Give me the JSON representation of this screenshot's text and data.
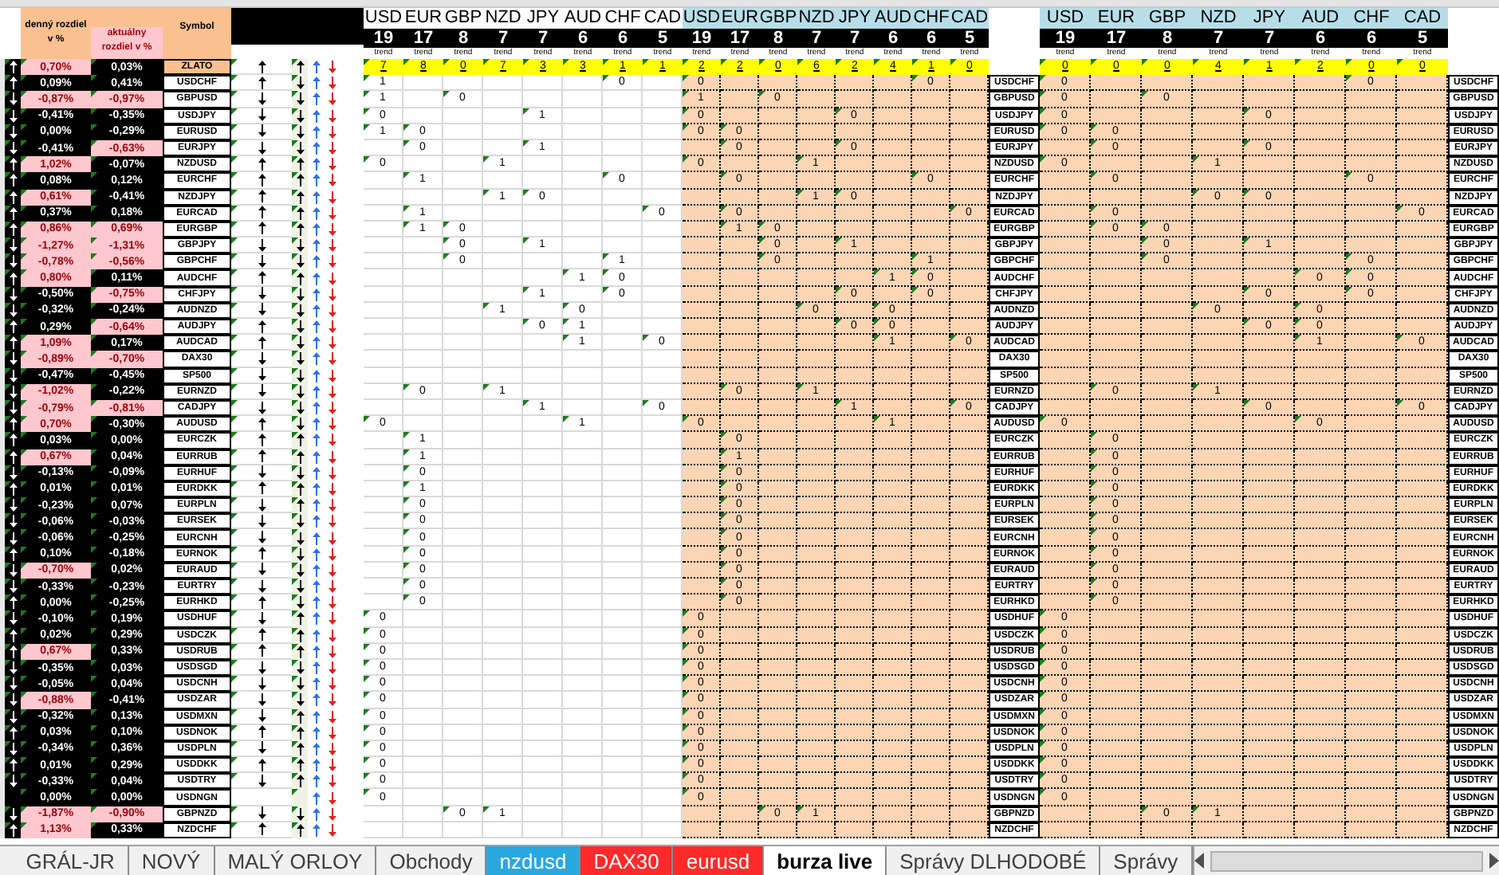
{
  "header": {
    "daily_label": "denný rozdiel v %",
    "current_label": "aktuálny rozdiel v %",
    "symbol_label": "Symbol"
  },
  "tables": [
    {
      "columns": [
        {
          "code": "USD",
          "count": "19",
          "trend": "trend",
          "score": "7"
        },
        {
          "code": "EUR",
          "count": "17",
          "trend": "trend",
          "score": "8"
        },
        {
          "code": "GBP",
          "count": "8",
          "trend": "trend",
          "score": "0"
        },
        {
          "code": "NZD",
          "count": "7",
          "trend": "trend",
          "score": "7"
        },
        {
          "code": "JPY",
          "count": "7",
          "trend": "trend",
          "score": "3"
        },
        {
          "code": "AUD",
          "count": "6",
          "trend": "trend",
          "score": "3"
        },
        {
          "code": "CHF",
          "count": "6",
          "trend": "trend",
          "score": "1"
        },
        {
          "code": "CAD",
          "count": "5",
          "trend": "trend",
          "score": "1"
        }
      ]
    },
    {
      "columns": [
        {
          "code": "USD",
          "count": "19",
          "trend": "trend",
          "score": "2"
        },
        {
          "code": "EUR",
          "count": "17",
          "trend": "trend",
          "score": "2"
        },
        {
          "code": "GBP",
          "count": "8",
          "trend": "trend",
          "score": "0"
        },
        {
          "code": "NZD",
          "count": "7",
          "trend": "trend",
          "score": "6"
        },
        {
          "code": "JPY",
          "count": "7",
          "trend": "trend",
          "score": "2"
        },
        {
          "code": "AUD",
          "count": "6",
          "trend": "trend",
          "score": "4"
        },
        {
          "code": "CHF",
          "count": "6",
          "trend": "trend",
          "score": "1"
        },
        {
          "code": "CAD",
          "count": "5",
          "trend": "trend",
          "score": "0"
        }
      ]
    },
    {
      "columns": [
        {
          "code": "USD",
          "count": "19",
          "trend": "trend",
          "score": "0"
        },
        {
          "code": "EUR",
          "count": "17",
          "trend": "trend",
          "score": "0"
        },
        {
          "code": "GBP",
          "count": "8",
          "trend": "trend",
          "score": "0"
        },
        {
          "code": "NZD",
          "count": "7",
          "trend": "trend",
          "score": "4"
        },
        {
          "code": "JPY",
          "count": "7",
          "trend": "trend",
          "score": "1"
        },
        {
          "code": "AUD",
          "count": "6",
          "trend": "trend",
          "score": "2"
        },
        {
          "code": "CHF",
          "count": "6",
          "trend": "trend",
          "score": "0"
        },
        {
          "code": "CAD",
          "count": "5",
          "trend": "trend",
          "score": "0"
        }
      ]
    }
  ],
  "rows": [
    {
      "symbol": "ZLATO",
      "symbol_highlight": true,
      "daily": "0,70%",
      "daily_flag": true,
      "current": "0,03%",
      "current_flag": false,
      "a_up": true,
      "b_up": true,
      "c_up": true
    },
    {
      "symbol": "USDCHF",
      "symbol_mid": "USDCHF",
      "symbol_right": "USDCHF",
      "daily": "0,09%",
      "daily_flag": false,
      "current": "0,41%",
      "current_flag": false,
      "a_up": true,
      "b_up": true,
      "c_up": false,
      "t1": {
        "usd": "1",
        "chf": "0"
      },
      "t2": {
        "usd": "0",
        "chf": "0"
      },
      "t3": {
        "usd": "0",
        "chf": "0"
      }
    },
    {
      "symbol": "GBPUSD",
      "symbol_mid": "GBPUSD",
      "symbol_right": "GBPUSD",
      "daily": "-0,87%",
      "daily_flag": true,
      "current": "-0,97%",
      "current_flag": true,
      "a_up": false,
      "b_up": false,
      "c_up": false,
      "t1": {
        "usd": "1",
        "gbp": "0"
      },
      "t2": {
        "usd": "1",
        "gbp": "0"
      },
      "t3": {
        "usd": "0",
        "gbp": "0"
      }
    },
    {
      "symbol": "USDJPY",
      "symbol_mid": "USDJPY",
      "symbol_right": "USDJPY",
      "daily": "-0,41%",
      "daily_flag": false,
      "current": "-0,35%",
      "current_flag": false,
      "a_up": false,
      "b_up": false,
      "c_up": false,
      "t1": {
        "usd": "0",
        "jpy": "1"
      },
      "t2": {
        "usd": "0",
        "jpy": "0"
      },
      "t3": {
        "usd": "0",
        "jpy": "0"
      }
    },
    {
      "symbol": "EURUSD",
      "symbol_mid": "EURUSD",
      "symbol_right": "EURUSD",
      "daily": "0,00%",
      "daily_flag": false,
      "current": "-0,29%",
      "current_flag": false,
      "a_up": false,
      "b_up": false,
      "c_up": false,
      "t1": {
        "usd": "1",
        "eur": "0"
      },
      "t2": {
        "usd": "0",
        "eur": "0"
      },
      "t3": {
        "usd": "0",
        "eur": "0"
      }
    },
    {
      "symbol": "EURJPY",
      "symbol_mid": "EURJPY",
      "symbol_right": "EURJPY",
      "daily": "-0,41%",
      "daily_flag": false,
      "current": "-0,63%",
      "current_flag": true,
      "a_up": false,
      "b_up": false,
      "c_up": false,
      "t1": {
        "eur": "0",
        "jpy": "1"
      },
      "t2": {
        "eur": "0",
        "jpy": "0"
      },
      "t3": {
        "eur": "0",
        "jpy": "0"
      }
    },
    {
      "symbol": "NZDUSD",
      "symbol_mid": "NZDUSD",
      "symbol_right": "NZDUSD",
      "daily": "1,02%",
      "daily_flag": true,
      "current": "-0,07%",
      "current_flag": false,
      "a_up": true,
      "b_up": true,
      "c_up": true,
      "t1": {
        "usd": "0",
        "nzd": "1"
      },
      "t2": {
        "usd": "0",
        "nzd": "1"
      },
      "t3": {
        "usd": "0",
        "nzd": "1"
      }
    },
    {
      "symbol": "EURCHF",
      "symbol_mid": "EURCHF",
      "symbol_right": "EURCHF",
      "daily": "0,08%",
      "daily_flag": false,
      "current": "0,12%",
      "current_flag": false,
      "a_up": true,
      "b_up": true,
      "c_up": true,
      "t1": {
        "eur": "1",
        "chf": "0"
      },
      "t2": {
        "eur": "0",
        "chf": "0"
      },
      "t3": {
        "eur": "0",
        "chf": "0"
      }
    },
    {
      "symbol": "NZDJPY",
      "symbol_mid": "NZDJPY",
      "symbol_right": "NZDJPY",
      "daily": "0,61%",
      "daily_flag": true,
      "current": "-0,41%",
      "current_flag": false,
      "a_up": true,
      "b_up": true,
      "c_up": true,
      "t1": {
        "nzd": "1",
        "jpy": "0"
      },
      "t2": {
        "nzd": "1",
        "jpy": "0"
      },
      "t3": {
        "nzd": "0",
        "jpy": "0"
      }
    },
    {
      "symbol": "EURCAD",
      "symbol_mid": "EURCAD",
      "symbol_right": "EURCAD",
      "daily": "0,37%",
      "daily_flag": false,
      "current": "0,18%",
      "current_flag": false,
      "a_up": true,
      "b_up": true,
      "c_up": true,
      "t1": {
        "eur": "1",
        "cad": "0"
      },
      "t2": {
        "eur": "0",
        "cad": "0"
      },
      "t3": {
        "eur": "0",
        "cad": "0"
      }
    },
    {
      "symbol": "EURGBP",
      "symbol_mid": "EURGBP",
      "symbol_right": "EURGBP",
      "daily": "0,86%",
      "daily_flag": true,
      "current": "0,69%",
      "current_flag": true,
      "a_up": true,
      "b_up": true,
      "c_up": true,
      "t1": {
        "eur": "1",
        "gbp": "0"
      },
      "t2": {
        "eur": "1",
        "gbp": "0"
      },
      "t3": {
        "eur": "0",
        "gbp": "0"
      }
    },
    {
      "symbol": "GBPJPY",
      "symbol_mid": "GBPJPY",
      "symbol_right": "GBPJPY",
      "daily": "-1,27%",
      "daily_flag": true,
      "current": "-1,31%",
      "current_flag": true,
      "a_up": false,
      "b_up": false,
      "c_up": false,
      "t1": {
        "gbp": "0",
        "jpy": "1"
      },
      "t2": {
        "gbp": "0",
        "jpy": "1"
      },
      "t3": {
        "gbp": "0",
        "jpy": "1"
      }
    },
    {
      "symbol": "GBPCHF",
      "symbol_mid": "GBPCHF",
      "symbol_right": "GBPCHF",
      "daily": "-0,78%",
      "daily_flag": true,
      "current": "-0,56%",
      "current_flag": true,
      "a_up": false,
      "b_up": false,
      "c_up": false,
      "t1": {
        "gbp": "0",
        "chf": "1"
      },
      "t2": {
        "gbp": "0",
        "chf": "1"
      },
      "t3": {
        "gbp": "0",
        "chf": "0"
      }
    },
    {
      "symbol": "AUDCHF",
      "symbol_mid": "AUDCHF",
      "symbol_right": "AUDCHF",
      "daily": "0,80%",
      "daily_flag": true,
      "current": "0,11%",
      "current_flag": false,
      "a_up": true,
      "b_up": true,
      "c_up": true,
      "t1": {
        "aud": "1",
        "chf": "0"
      },
      "t2": {
        "aud": "1",
        "chf": "0"
      },
      "t3": {
        "aud": "0",
        "chf": "0"
      }
    },
    {
      "symbol": "CHFJPY",
      "symbol_mid": "CHFJPY",
      "symbol_right": "CHFJPY",
      "daily": "-0,50%",
      "daily_flag": false,
      "current": "-0,75%",
      "current_flag": true,
      "a_up": false,
      "b_up": false,
      "c_up": false,
      "t1": {
        "jpy": "1",
        "chf": "0"
      },
      "t2": {
        "jpy": "0",
        "chf": "0"
      },
      "t3": {
        "jpy": "0",
        "chf": "0"
      }
    },
    {
      "symbol": "AUDNZD",
      "symbol_mid": "AUDNZD",
      "symbol_right": "AUDNZD",
      "daily": "-0,32%",
      "daily_flag": false,
      "current": "-0,24%",
      "current_flag": false,
      "a_up": false,
      "b_up": false,
      "c_up": false,
      "t1": {
        "nzd": "1",
        "aud": "0"
      },
      "t2": {
        "nzd": "0",
        "aud": "0"
      },
      "t3": {
        "nzd": "0",
        "aud": "0"
      }
    },
    {
      "symbol": "AUDJPY",
      "symbol_mid": "AUDJPY",
      "symbol_right": "AUDJPY",
      "daily": "0,29%",
      "daily_flag": false,
      "current": "-0,64%",
      "current_flag": true,
      "a_up": true,
      "b_up": true,
      "c_up": false,
      "t1": {
        "jpy": "0",
        "aud": "1"
      },
      "t2": {
        "jpy": "0",
        "aud": "0"
      },
      "t3": {
        "jpy": "0",
        "aud": "0"
      }
    },
    {
      "symbol": "AUDCAD",
      "symbol_mid": "AUDCAD",
      "symbol_right": "AUDCAD",
      "daily": "1,09%",
      "daily_flag": true,
      "current": "0,17%",
      "current_flag": false,
      "a_up": true,
      "b_up": true,
      "c_up": false,
      "t1": {
        "aud": "1",
        "cad": "0"
      },
      "t2": {
        "aud": "1",
        "cad": "0"
      },
      "t3": {
        "aud": "1",
        "cad": "0"
      }
    },
    {
      "symbol": "DAX30",
      "symbol_mid": "DAX30",
      "symbol_right": "DAX30",
      "daily": "-0,89%",
      "daily_flag": true,
      "current": "-0,70%",
      "current_flag": true,
      "a_up": false,
      "b_up": false,
      "c_up": false
    },
    {
      "symbol": "SP500",
      "symbol_mid": "SP500",
      "symbol_right": "SP500",
      "daily": "-0,47%",
      "daily_flag": false,
      "current": "-0,45%",
      "current_flag": false,
      "a_up": false,
      "b_up": false,
      "c_up": false
    },
    {
      "symbol": "EURNZD",
      "symbol_mid": "EURNZD",
      "symbol_right": "EURNZD",
      "daily": "-1,02%",
      "daily_flag": true,
      "current": "-0,22%",
      "current_flag": false,
      "a_up": false,
      "b_up": false,
      "c_up": false,
      "t1": {
        "eur": "0",
        "nzd": "1"
      },
      "t2": {
        "eur": "0",
        "nzd": "1"
      },
      "t3": {
        "eur": "0",
        "nzd": "1"
      }
    },
    {
      "symbol": "CADJPY",
      "symbol_mid": "CADJPY",
      "symbol_right": "CADJPY",
      "daily": "-0,79%",
      "daily_flag": true,
      "current": "-0,81%",
      "current_flag": true,
      "a_up": false,
      "b_up": false,
      "c_up": false,
      "t1": {
        "jpy": "1",
        "cad": "0"
      },
      "t2": {
        "jpy": "1",
        "cad": "0"
      },
      "t3": {
        "jpy": "0",
        "cad": "0"
      }
    },
    {
      "symbol": "AUDUSD",
      "symbol_mid": "AUDUSD",
      "symbol_right": "AUDUSD",
      "daily": "0,70%",
      "daily_flag": true,
      "current": "-0,30%",
      "current_flag": false,
      "a_up": true,
      "b_up": true,
      "c_up": false,
      "t1": {
        "usd": "0",
        "aud": "1"
      },
      "t2": {
        "usd": "0",
        "aud": "1"
      },
      "t3": {
        "usd": "0",
        "aud": "0"
      }
    },
    {
      "symbol": "EURCZK",
      "symbol_mid": "EURCZK",
      "symbol_right": "EURCZK",
      "daily": "0,03%",
      "daily_flag": false,
      "current": "0,00%",
      "current_flag": false,
      "a_up": true,
      "b_up": true,
      "c_up": true,
      "t1": {
        "eur": "1"
      },
      "t2": {
        "eur": "0"
      },
      "t3": {
        "eur": "0"
      }
    },
    {
      "symbol": "EURRUB",
      "symbol_mid": "EURRUB",
      "symbol_right": "EURRUB",
      "daily": "0,67%",
      "daily_flag": true,
      "current": "0,04%",
      "current_flag": false,
      "a_up": true,
      "b_up": true,
      "c_up": true,
      "t1": {
        "eur": "1"
      },
      "t2": {
        "eur": "1"
      },
      "t3": {
        "eur": "0"
      }
    },
    {
      "symbol": "EURHUF",
      "symbol_mid": "EURHUF",
      "symbol_right": "EURHUF",
      "daily": "-0,13%",
      "daily_flag": false,
      "current": "-0,09%",
      "current_flag": false,
      "a_up": false,
      "b_up": false,
      "c_up": false,
      "t1": {
        "eur": "0"
      },
      "t2": {
        "eur": "0"
      },
      "t3": {
        "eur": "0"
      }
    },
    {
      "symbol": "EURDKK",
      "symbol_mid": "EURDKK",
      "symbol_right": "EURDKK",
      "daily": "0,01%",
      "daily_flag": false,
      "current": "0,01%",
      "current_flag": false,
      "a_up": true,
      "b_up": true,
      "c_up": true,
      "t1": {
        "eur": "1"
      },
      "t2": {
        "eur": "0"
      },
      "t3": {
        "eur": "0"
      }
    },
    {
      "symbol": "EURPLN",
      "symbol_mid": "EURPLN",
      "symbol_right": "EURPLN",
      "daily": "-0,23%",
      "daily_flag": false,
      "current": "0,07%",
      "current_flag": false,
      "a_up": false,
      "b_up": false,
      "c_up": true,
      "t1": {
        "eur": "0"
      },
      "t2": {
        "eur": "0"
      },
      "t3": {
        "eur": "0"
      }
    },
    {
      "symbol": "EURSEK",
      "symbol_mid": "EURSEK",
      "symbol_right": "EURSEK",
      "daily": "-0,06%",
      "daily_flag": false,
      "current": "-0,03%",
      "current_flag": false,
      "a_up": false,
      "b_up": false,
      "c_up": false,
      "t1": {
        "eur": "0"
      },
      "t2": {
        "eur": "0"
      },
      "t3": {
        "eur": "0"
      }
    },
    {
      "symbol": "EURCNH",
      "symbol_mid": "EURCNH",
      "symbol_right": "EURCNH",
      "daily": "-0,06%",
      "daily_flag": false,
      "current": "-0,25%",
      "current_flag": false,
      "a_up": false,
      "b_up": false,
      "c_up": false,
      "t1": {
        "eur": "0"
      },
      "t2": {
        "eur": "0"
      },
      "t3": {
        "eur": "0"
      }
    },
    {
      "symbol": "EURNOK",
      "symbol_mid": "EURNOK",
      "symbol_right": "EURNOK",
      "daily": "0,10%",
      "daily_flag": false,
      "current": "-0,18%",
      "current_flag": false,
      "a_up": true,
      "b_up": true,
      "c_up": false,
      "t1": {
        "eur": "0"
      },
      "t2": {
        "eur": "0"
      },
      "t3": {
        "eur": "0"
      }
    },
    {
      "symbol": "EURAUD",
      "symbol_mid": "EURAUD",
      "symbol_right": "EURAUD",
      "daily": "-0,70%",
      "daily_flag": true,
      "current": "0,02%",
      "current_flag": false,
      "a_up": false,
      "b_up": false,
      "c_up": false,
      "t1": {
        "eur": "0"
      },
      "t2": {
        "eur": "0"
      },
      "t3": {
        "eur": "0"
      }
    },
    {
      "symbol": "EURTRY",
      "symbol_mid": "EURTRY",
      "symbol_right": "EURTRY",
      "daily": "-0,33%",
      "daily_flag": false,
      "current": "-0,23%",
      "current_flag": false,
      "a_up": false,
      "b_up": false,
      "c_up": false,
      "t1": {
        "eur": "0"
      },
      "t2": {
        "eur": "0"
      },
      "t3": {
        "eur": "0"
      }
    },
    {
      "symbol": "EURHKD",
      "symbol_mid": "EURHKD",
      "symbol_right": "EURHKD",
      "daily": "0,00%",
      "daily_flag": false,
      "current": "-0,25%",
      "current_flag": false,
      "a_up": true,
      "b_up": true,
      "c_up": false,
      "t1": {
        "eur": "0"
      },
      "t2": {
        "eur": "0"
      },
      "t3": {
        "eur": "0"
      }
    },
    {
      "symbol": "USDHUF",
      "symbol_mid": "USDHUF",
      "symbol_right": "USDHUF",
      "daily": "-0,10%",
      "daily_flag": false,
      "current": "0,19%",
      "current_flag": false,
      "a_up": false,
      "b_up": false,
      "c_up": true,
      "t1": {
        "usd": "0"
      },
      "t2": {
        "usd": "0"
      },
      "t3": {
        "usd": "0"
      }
    },
    {
      "symbol": "USDCZK",
      "symbol_mid": "USDCZK",
      "symbol_right": "USDCZK",
      "daily": "0,02%",
      "daily_flag": false,
      "current": "0,29%",
      "current_flag": false,
      "a_up": true,
      "b_up": true,
      "c_up": true,
      "t1": {
        "usd": "0"
      },
      "t2": {
        "usd": "0"
      },
      "t3": {
        "usd": "0"
      }
    },
    {
      "symbol": "USDRUB",
      "symbol_mid": "USDRUB",
      "symbol_right": "USDRUB",
      "daily": "0,67%",
      "daily_flag": true,
      "current": "0,33%",
      "current_flag": false,
      "a_up": true,
      "b_up": true,
      "c_up": true,
      "t1": {
        "usd": "0"
      },
      "t2": {
        "usd": "0"
      },
      "t3": {
        "usd": "0"
      }
    },
    {
      "symbol": "USDSGD",
      "symbol_mid": "USDSGD",
      "symbol_right": "USDSGD",
      "daily": "-0,35%",
      "daily_flag": false,
      "current": "0,03%",
      "current_flag": false,
      "a_up": false,
      "b_up": false,
      "c_up": false,
      "t1": {
        "usd": "0"
      },
      "t2": {
        "usd": "0"
      },
      "t3": {
        "usd": "0"
      }
    },
    {
      "symbol": "USDCNH",
      "symbol_mid": "USDCNH",
      "symbol_right": "USDCNH",
      "daily": "-0,05%",
      "daily_flag": false,
      "current": "0,04%",
      "current_flag": false,
      "a_up": false,
      "b_up": false,
      "c_up": false,
      "t1": {
        "usd": "0"
      },
      "t2": {
        "usd": "0"
      },
      "t3": {
        "usd": "0"
      }
    },
    {
      "symbol": "USDZAR",
      "symbol_mid": "USDZAR",
      "symbol_right": "USDZAR",
      "daily": "-0,88%",
      "daily_flag": true,
      "current": "-0,41%",
      "current_flag": false,
      "a_up": false,
      "b_up": false,
      "c_up": false,
      "t1": {
        "usd": "0"
      },
      "t2": {
        "usd": "0"
      },
      "t3": {
        "usd": "0"
      }
    },
    {
      "symbol": "USDMXN",
      "symbol_mid": "USDMXN",
      "symbol_right": "USDMXN",
      "daily": "-0,32%",
      "daily_flag": false,
      "current": "0,13%",
      "current_flag": false,
      "a_up": false,
      "b_up": false,
      "c_up": true,
      "t1": {
        "usd": "0"
      },
      "t2": {
        "usd": "0"
      },
      "t3": {
        "usd": "0"
      }
    },
    {
      "symbol": "USDNOK",
      "symbol_mid": "USDNOK",
      "symbol_right": "USDNOK",
      "daily": "0,03%",
      "daily_flag": false,
      "current": "0,10%",
      "current_flag": false,
      "a_up": true,
      "b_up": true,
      "c_up": true,
      "t1": {
        "usd": "0"
      },
      "t2": {
        "usd": "0"
      },
      "t3": {
        "usd": "0"
      }
    },
    {
      "symbol": "USDPLN",
      "symbol_mid": "USDPLN",
      "symbol_right": "USDPLN",
      "daily": "-0,34%",
      "daily_flag": false,
      "current": "0,36%",
      "current_flag": false,
      "a_up": false,
      "b_up": false,
      "c_up": true,
      "t1": {
        "usd": "0"
      },
      "t2": {
        "usd": "0"
      },
      "t3": {
        "usd": "0"
      }
    },
    {
      "symbol": "USDDKK",
      "symbol_mid": "USDDKK",
      "symbol_right": "USDDKK",
      "daily": "0,01%",
      "daily_flag": false,
      "current": "0,29%",
      "current_flag": false,
      "a_up": true,
      "b_up": true,
      "c_up": true,
      "t1": {
        "usd": "0"
      },
      "t2": {
        "usd": "0"
      },
      "t3": {
        "usd": "0"
      }
    },
    {
      "symbol": "USDTRY",
      "symbol_mid": "USDTRY",
      "symbol_right": "USDTRY",
      "daily": "-0,33%",
      "daily_flag": false,
      "current": "0,04%",
      "current_flag": false,
      "a_up": false,
      "b_up": false,
      "c_up": true,
      "t1": {
        "usd": "0"
      },
      "t2": {
        "usd": "0"
      },
      "t3": {
        "usd": "0"
      }
    },
    {
      "symbol": "USDNGN",
      "symbol_mid": "USDNGN",
      "symbol_right": "USDNGN",
      "daily": "0,00%",
      "daily_flag": false,
      "current": "0,00%",
      "current_flag": false,
      "t1": {
        "usd": "0"
      },
      "t2": {
        "usd": "0"
      },
      "t3": {
        "usd": "0"
      }
    },
    {
      "symbol": "GBPNZD",
      "symbol_mid": "GBPNZD",
      "symbol_right": "GBPNZD",
      "daily": "-1,87%",
      "daily_flag": true,
      "current": "-0,90%",
      "current_flag": true,
      "a_up": false,
      "b_up": false,
      "c_up": false,
      "t1": {
        "gbp": "0",
        "nzd": "1"
      },
      "t2": {
        "gbp": "0",
        "nzd": "1"
      },
      "t3": {
        "gbp": "0",
        "nzd": "1"
      }
    },
    {
      "symbol": "NZDCHF",
      "symbol_mid": "NZDCHF",
      "symbol_right": "NZDCHF",
      "daily": "1,13%",
      "daily_flag": true,
      "current": "0,33%",
      "current_flag": false,
      "a_up": true,
      "b_up": true,
      "c_up": true
    }
  ],
  "sheet_tabs": [
    {
      "label": "GRÁL-JR",
      "selected": false
    },
    {
      "label": "NOVÝ",
      "selected": false
    },
    {
      "label": "MALÝ ORLOY",
      "selected": false
    },
    {
      "label": "Obchody",
      "selected": false
    },
    {
      "label": "nzdusd",
      "selected": false,
      "color": "#29a8e0"
    },
    {
      "label": "DAX30",
      "selected": false,
      "color": "#ff2a2a"
    },
    {
      "label": "eurusd",
      "selected": false,
      "color": "#ff2a2a"
    },
    {
      "label": "burza live",
      "selected": true
    },
    {
      "label": "Správy DLHODOBÉ",
      "selected": false
    },
    {
      "label": "Správy",
      "selected": false
    }
  ]
}
